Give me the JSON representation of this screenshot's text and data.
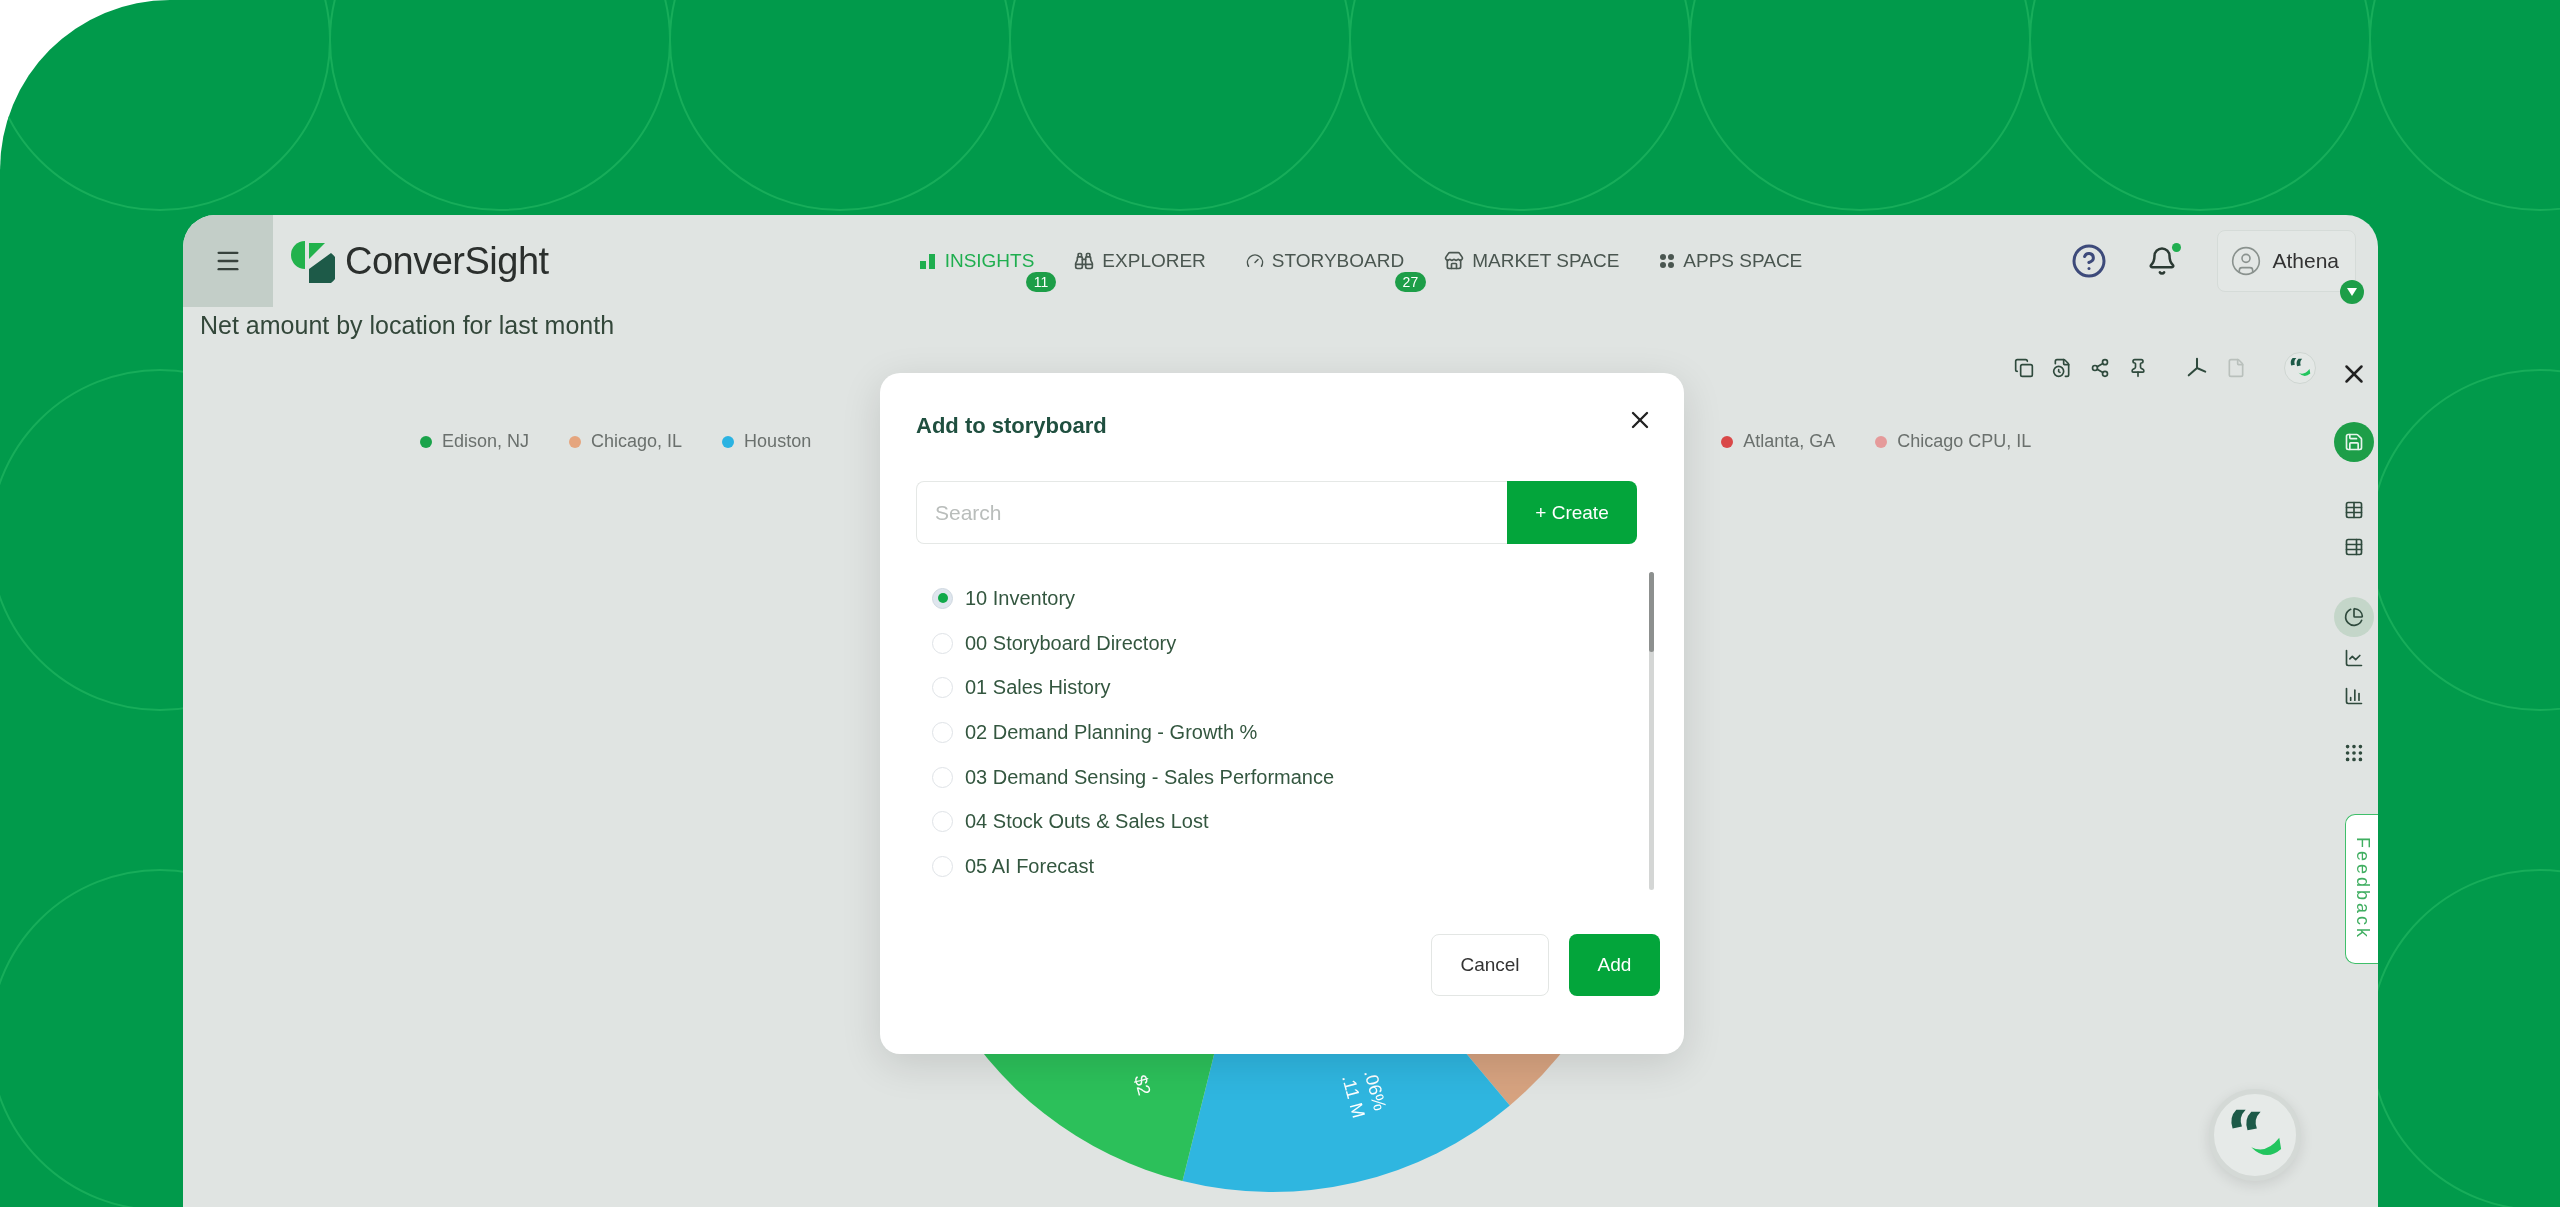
{
  "app": {
    "brand": "ConverSight"
  },
  "nav": [
    {
      "label": "INSIGHTS",
      "selected": true,
      "badge": "11"
    },
    {
      "label": "EXPLORER",
      "selected": false
    },
    {
      "label": "STORYBOARD",
      "selected": false,
      "badge": "27"
    },
    {
      "label": "MARKET SPACE",
      "selected": false
    },
    {
      "label": "APPS SPACE",
      "selected": false
    }
  ],
  "notifications": {
    "unread": true
  },
  "user": {
    "name": "Athena"
  },
  "page_title": "Net amount by location for last month",
  "xlsx_export": {
    "disabled": true
  },
  "legend": [
    {
      "label": "Edison, NJ",
      "color": "#1aa34a"
    },
    {
      "label": "Chicago, IL",
      "color": "#e5a57e"
    },
    {
      "label": "Houston",
      "color": "#2bb3e2"
    },
    {
      "label": "Atlanta, GA",
      "color": "#d94848"
    },
    {
      "label": "Chicago CPU, IL",
      "color": "#e59a9a"
    }
  ],
  "chart": {
    "slice_labels": [
      "$2",
      ".06%",
      ".11 M"
    ]
  },
  "chart_types": [
    {
      "selected": false
    },
    {
      "selected": false
    },
    {
      "selected": true
    },
    {
      "selected": false
    },
    {
      "selected": false
    }
  ],
  "feedback_tab": "Feedback",
  "dialog": {
    "title": "Add to storyboard",
    "search": {
      "placeholder": "Search"
    },
    "create_button": "+ Create",
    "options": [
      {
        "label": "10 Inventory",
        "selected": true
      },
      {
        "label": "00 Storyboard Directory",
        "selected": false
      },
      {
        "label": "01 Sales History",
        "selected": false
      },
      {
        "label": "02 Demand Planning - Growth %",
        "selected": false
      },
      {
        "label": "03 Demand Sensing - Sales Performance",
        "selected": false
      },
      {
        "label": "04 Stock Outs & Sales Lost",
        "selected": false
      },
      {
        "label": "05 AI Forecast",
        "selected": false
      }
    ],
    "cancel_button": "Cancel",
    "confirm_button": "Add"
  }
}
